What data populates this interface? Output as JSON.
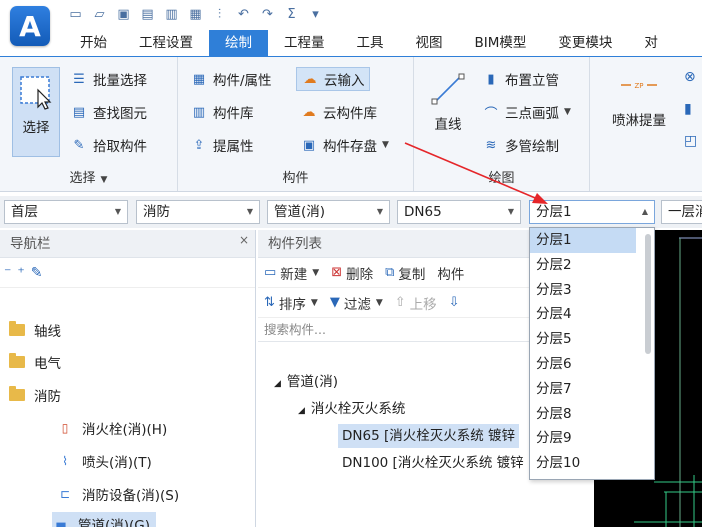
{
  "app": {
    "logo_letter": "A"
  },
  "tabs": [
    "开始",
    "工程设置",
    "绘制",
    "工程量",
    "工具",
    "视图",
    "BIM模型",
    "变更模块",
    "对"
  ],
  "active_tab": "绘制",
  "ribbon": {
    "select_group": {
      "label": "选择",
      "big_button": "选择",
      "buttons": [
        "批量选择",
        "查找图元",
        "拾取构件"
      ]
    },
    "component_group": {
      "label": "构件",
      "col1": [
        "构件/属性",
        "构件库",
        "提属性"
      ],
      "col2": [
        "云输入",
        "云构件库",
        "构件存盘"
      ]
    },
    "draw_group": {
      "label": "绘图",
      "big_button": "直线",
      "buttons": [
        "布置立管",
        "三点画弧",
        "多管绘制"
      ]
    },
    "extra_group": {
      "big_button": "喷淋提量"
    }
  },
  "combos": {
    "floor": "首层",
    "specialty": "消防",
    "type": "管道(消)",
    "size": "DN65",
    "layer": "分层1",
    "last": "一层消"
  },
  "dropdown": {
    "items": [
      "分层1",
      "分层2",
      "分层3",
      "分层4",
      "分层5",
      "分层6",
      "分层7",
      "分层8",
      "分层9",
      "分层10"
    ],
    "selected": "分层1"
  },
  "nav": {
    "title": "导航栏",
    "items": [
      {
        "label": "轴线"
      },
      {
        "label": "电气"
      },
      {
        "label": "消防"
      },
      {
        "label": "消火栓(消)(H)"
      },
      {
        "label": "喷头(消)(T)"
      },
      {
        "label": "消防设备(消)(S)"
      },
      {
        "label": "管道(消)(G)"
      }
    ]
  },
  "component_list": {
    "title": "构件列表",
    "toolbar1": [
      "新建",
      "删除",
      "复制",
      "构件"
    ],
    "toolbar2": [
      "排序",
      "过滤",
      "上移"
    ],
    "search_placeholder": "搜索构件...",
    "tree": {
      "root": "管道(消)",
      "system": "消火栓灭火系统",
      "items": [
        "DN65 [消火栓灭火系统 镀锌",
        "DN100 [消火栓灭火系统 镀锌"
      ]
    }
  }
}
